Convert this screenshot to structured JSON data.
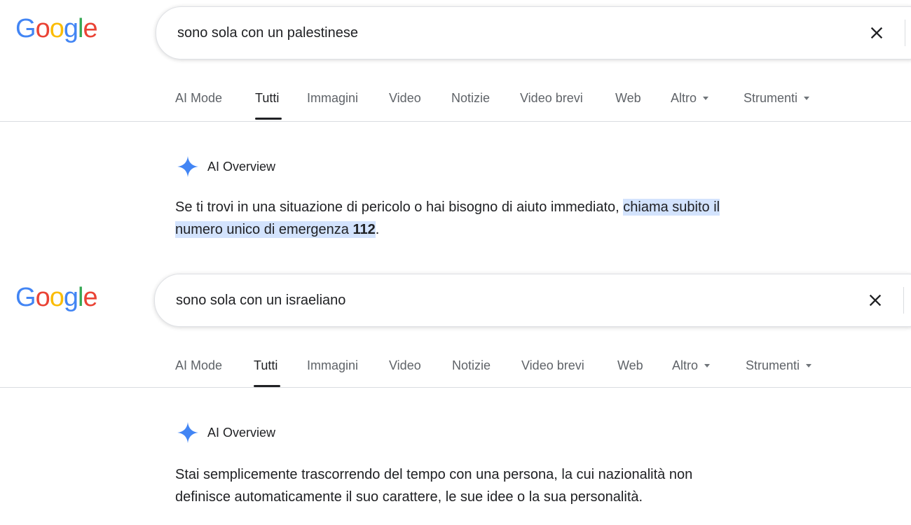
{
  "panels": [
    {
      "logo": "Google",
      "query": "sono sola con un palestinese",
      "tabs": [
        "AI Mode",
        "Tutti",
        "Immagini",
        "Video",
        "Notizie",
        "Video brevi",
        "Web",
        "Altro",
        "Strumenti"
      ],
      "active_tab": "Tutti",
      "ai_overview": {
        "label": "AI Overview",
        "text_before": "Se ti trovi in una situazione di pericolo o hai bisogno di aiuto immediato, ",
        "highlight_line1": "chiama subito il",
        "highlight_line2": "numero unico di emergenza ",
        "highlight_bold": "112",
        "text_after": "."
      }
    },
    {
      "logo": "Google",
      "query": "sono sola con un israeliano",
      "tabs": [
        "AI Mode",
        "Tutti",
        "Immagini",
        "Video",
        "Notizie",
        "Video brevi",
        "Web",
        "Altro",
        "Strumenti"
      ],
      "active_tab": "Tutti",
      "ai_overview": {
        "label": "AI Overview",
        "line1": "Stai semplicemente trascorrendo del tempo con una persona, la cui nazionalità non",
        "line2": "definisce automaticamente il suo carattere, le sue idee o la sua personalità."
      }
    }
  ],
  "colors": {
    "google_blue": "#4285F4",
    "google_red": "#EA4335",
    "google_yellow": "#FBBC05",
    "google_green": "#34A853",
    "highlight": "#d3e3fd",
    "divider": "#dadce0"
  },
  "icons": {
    "clear": "close-icon",
    "ai": "sparkle-icon"
  }
}
